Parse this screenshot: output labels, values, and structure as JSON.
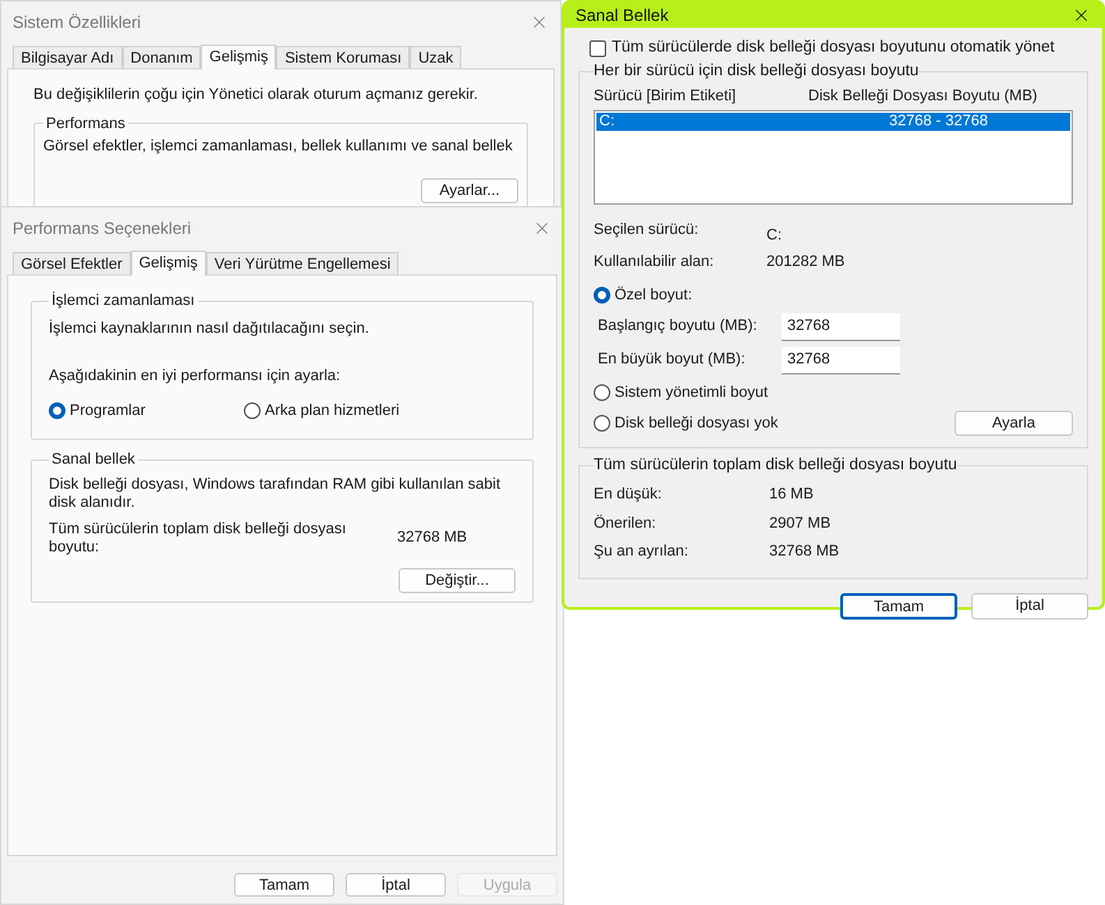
{
  "system_properties": {
    "title": "Sistem Özellikleri",
    "tabs": [
      {
        "label": "Bilgisayar Adı",
        "selected": false
      },
      {
        "label": "Donanım",
        "selected": false
      },
      {
        "label": "Gelişmiş",
        "selected": true
      },
      {
        "label": "Sistem Koruması",
        "selected": false
      },
      {
        "label": "Uzak",
        "selected": false
      }
    ],
    "notice": "Bu değişiklilerin çoğu için Yönetici olarak oturum açmanız gerekir.",
    "performance_group": {
      "title": "Performans",
      "text": "Görsel efektler, işlemci zamanlaması, bellek kullanımı ve sanal bellek",
      "button": "Ayarlar..."
    }
  },
  "performance_options": {
    "title": "Performans Seçenekleri",
    "tabs": [
      {
        "label": "Görsel Efektler",
        "selected": false
      },
      {
        "label": "Gelişmiş",
        "selected": true
      },
      {
        "label": "Veri Yürütme Engellemesi",
        "selected": false
      }
    ],
    "cpu_group": {
      "title": "İşlemci zamanlaması",
      "description": "İşlemci kaynaklarının nasıl dağıtılacağını seçin.",
      "prompt": "Aşağıdakinin en iyi performansı için ayarla:",
      "options": [
        {
          "label": "Programlar",
          "selected": true
        },
        {
          "label": "Arka plan hizmetleri",
          "selected": false
        }
      ]
    },
    "vm_group": {
      "title": "Sanal bellek",
      "description": "Disk belleği dosyası, Windows tarafından RAM gibi kullanılan sabit disk alanıdır.",
      "total_label": "Tüm sürücülerin toplam disk belleği dosyası boyutu:",
      "total_value": "32768 MB",
      "button": "Değiştir..."
    },
    "buttons": [
      {
        "label": "Tamam",
        "disabled": false
      },
      {
        "label": "İptal",
        "disabled": false
      },
      {
        "label": "Uygula",
        "disabled": true
      }
    ]
  },
  "virtual_memory": {
    "title": "Sanal Bellek",
    "auto_manage": {
      "label": "Tüm sürücülerde disk belleği dosyası boyutunu otomatik yönet",
      "checked": false
    },
    "drives_group": {
      "title": "Her bir sürücü için disk belleği dosyası boyutu",
      "columns": [
        "Sürücü  [Birim Etiketi]",
        "Disk Belleği Dosyası Boyutu (MB)"
      ],
      "rows": [
        {
          "drive": "C:",
          "size": "32768 - 32768",
          "selected": true
        }
      ],
      "info": [
        {
          "label": "Seçilen sürücü:",
          "value": "C:"
        },
        {
          "label": "Kullanılabilir alan:",
          "value": "201282 MB"
        }
      ],
      "size_options": [
        {
          "kind": "custom",
          "label": "Özel boyut:",
          "selected": true,
          "fields": [
            {
              "label": "Başlangıç boyutu (MB):",
              "value": "32768"
            },
            {
              "label": "En büyük boyut (MB):",
              "value": "32768"
            }
          ]
        },
        {
          "kind": "plain",
          "label": "Sistem yönetimli boyut",
          "selected": false
        },
        {
          "kind": "plain",
          "label": "Disk belleği dosyası yok",
          "selected": false
        }
      ],
      "set_button": "Ayarla"
    },
    "totals_group": {
      "title": "Tüm sürücülerin toplam disk belleği dosyası boyutu",
      "rows": [
        {
          "label": "En düşük:",
          "value": "16 MB"
        },
        {
          "label": "Önerilen:",
          "value": "2907 MB"
        },
        {
          "label": "Şu an ayrılan:",
          "value": "32768 MB"
        }
      ]
    },
    "buttons": [
      {
        "label": "Tamam",
        "default": true
      },
      {
        "label": "İptal",
        "default": false
      }
    ]
  }
}
